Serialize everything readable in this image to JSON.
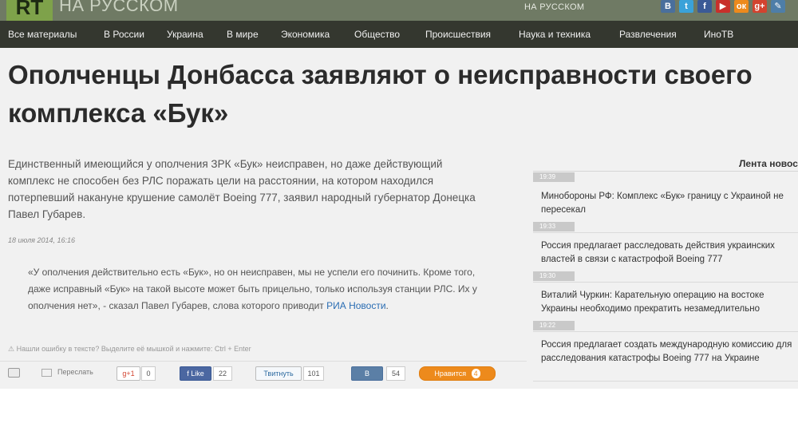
{
  "header": {
    "logo_mark": "RT",
    "logo_text": "НА РУССКОМ",
    "lang_label": "НА РУССКОМ",
    "social": [
      {
        "icon": "vk-icon",
        "glyph": "В",
        "color": "#4a6f9c"
      },
      {
        "icon": "twitter-icon",
        "glyph": "t",
        "color": "#3aa2d9"
      },
      {
        "icon": "facebook-icon",
        "glyph": "f",
        "color": "#3b5a96"
      },
      {
        "icon": "youtube-icon",
        "glyph": "▶",
        "color": "#c8302b"
      },
      {
        "icon": "odnoklassniki-icon",
        "glyph": "ок",
        "color": "#ed8a1c"
      },
      {
        "icon": "google-plus-icon",
        "glyph": "g+",
        "color": "#d2432f"
      },
      {
        "icon": "livejournal-icon",
        "glyph": "✎",
        "color": "#4e7ea8"
      }
    ]
  },
  "nav": [
    "Все материалы",
    "В России",
    "Украина",
    "В мире",
    "Экономика",
    "Общество",
    "Происшествия",
    "Наука и техника",
    "Развлечения",
    "ИноТВ"
  ],
  "article": {
    "headline": "Ополченцы Донбасса заявляют о неисправности своего комплекса «Бук»",
    "lead": "Единственный имеющийся у ополчения ЗРК «Бук» неисправен, но даже действующий комплекс не способен без РЛС поражать цели на расстоянии, на котором находился потерпевший накануне крушение самолёт Boeing 777, заявил народный губернатор Донецка Павел Губарев.",
    "date": "18 июля 2014, 16:16",
    "quote": "«У ополчения действительно есть «Бук», но он неисправен, мы не успели его починить. Кроме того, даже исправный «Бук» на такой высоте может быть прицельно, только используя станции РЛС. Их у ополчения нет», - сказал Павел Губарев, слова которого приводит",
    "quote_link": "РИА Новости",
    "quote_end": ".",
    "typo_notice": "⚠ Нашли ошибку в тексте? Выделите её мышкой и нажмите: Ctrl + Enter"
  },
  "share": {
    "forward_label": "Переслать",
    "gplus_label": "g+1",
    "gplus_count": "0",
    "fb_label": "f Like",
    "fb_count": "22",
    "tw_label": "Твитнуть",
    "tw_count": "101",
    "vk_label": "В",
    "vk_count": "54",
    "ok_label": "Нравится",
    "ok_count": "4"
  },
  "feed": {
    "title": "Лента новостей",
    "items": [
      {
        "time": "19:39",
        "text": "Минобороны РФ: Комплекс «Бук» границу с Украиной не пересекал"
      },
      {
        "time": "19:33",
        "text": "Россия предлагает расследовать действия украинских властей в связи с катастрофой Boeing 777"
      },
      {
        "time": "19:30",
        "text": "Виталий Чуркин: Карательную операцию на востоке Украины необходимо прекратить незамедлительно"
      },
      {
        "time": "19:22",
        "text": "Россия предлагает создать международную комиссию для расследования катастрофы Boeing 777 на Украине"
      }
    ]
  }
}
